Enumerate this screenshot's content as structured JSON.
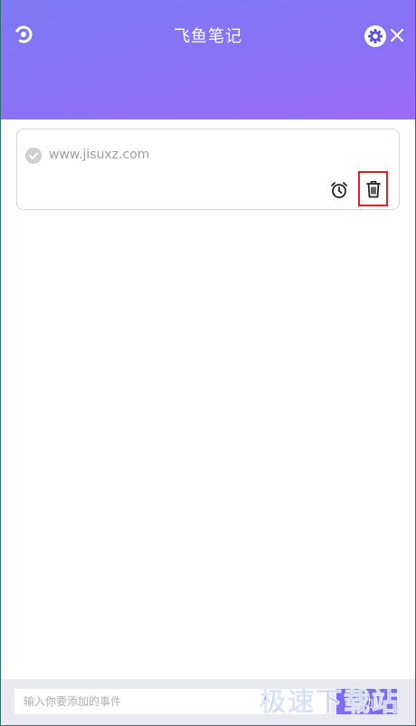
{
  "app": {
    "title": "飞鱼笔记"
  },
  "header": {
    "logo_icon": "spiral-logo-icon",
    "settings_icon": "gear-icon",
    "close_icon": "close-icon"
  },
  "notes": [
    {
      "text": "www.jisuxz.com",
      "done_icon": "check-circle-icon",
      "reminder_icon": "alarm-clock-icon",
      "delete_icon": "trash-icon"
    }
  ],
  "footer": {
    "input_placeholder": "输入你要添加的事件",
    "input_value": "",
    "add_label": "添加"
  },
  "watermark": "极速下载站",
  "colors": {
    "header_gradient_start": "#7e79f3",
    "header_gradient_end": "#9b6cf7",
    "highlight": "#e02020",
    "button": "#7b6cf2",
    "footer_bg": "#e9e9f1"
  }
}
